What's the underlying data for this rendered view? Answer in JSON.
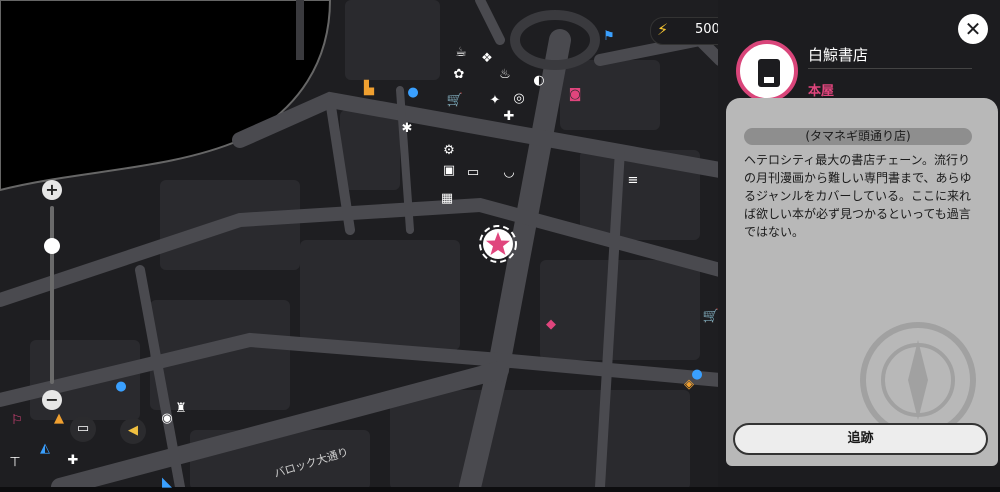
{
  "currency": {
    "icon": "lightning-crystal-icon",
    "value": "500"
  },
  "street_label": "バロック大通り",
  "shop": {
    "name": "白鯨書店",
    "type": "本屋",
    "subtitle": "(タマネギ頭通り店)",
    "description": "ヘテロシティ最大の書店チェーン。流行りの月刊漫画から難しい専門書まで、あらゆるジャンルをカバーしている。ここに来れば欲しい本が必ず見つかるといっても過言ではない。",
    "icon": "book-icon"
  },
  "buttons": {
    "track": "追跡",
    "close": "✕",
    "zoom_in": "+",
    "zoom_out": "−"
  },
  "colors": {
    "accent": "#e0457d",
    "panel": "#1c1c1f",
    "card": "#b8b8b8",
    "map_bg": "#0d0d0f"
  }
}
